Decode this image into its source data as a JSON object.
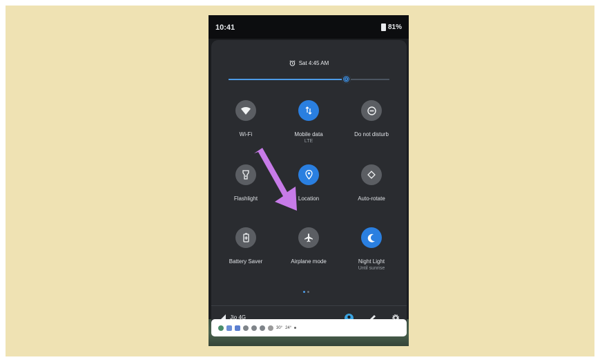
{
  "status_bar": {
    "time": "10:41",
    "battery": "81%"
  },
  "quick_settings": {
    "alarm": "Sat 4:45 AM",
    "brightness_level": 0.73,
    "tiles": [
      {
        "id": "wifi",
        "label": "Wi-Fi",
        "sublabel": "",
        "icon": "wifi-icon",
        "active": false
      },
      {
        "id": "mobile-data",
        "label": "Mobile data",
        "sublabel": "LTE",
        "icon": "mobile-data-icon",
        "active": true
      },
      {
        "id": "dnd",
        "label": "Do not disturb",
        "sublabel": "",
        "icon": "do-not-disturb-icon",
        "active": false
      },
      {
        "id": "flashlight",
        "label": "Flashlight",
        "sublabel": "",
        "icon": "flashlight-icon",
        "active": false
      },
      {
        "id": "location",
        "label": "Location",
        "sublabel": "",
        "icon": "location-icon",
        "active": true
      },
      {
        "id": "auto-rotate",
        "label": "Auto-rotate",
        "sublabel": "",
        "icon": "auto-rotate-icon",
        "active": false
      },
      {
        "id": "battery-saver",
        "label": "Battery Saver",
        "sublabel": "",
        "icon": "battery-saver-icon",
        "active": false
      },
      {
        "id": "airplane",
        "label": "Airplane mode",
        "sublabel": "",
        "icon": "airplane-icon",
        "active": false
      },
      {
        "id": "night-light",
        "label": "Night Light",
        "sublabel": "Until sunrise",
        "icon": "night-light-icon",
        "active": true
      }
    ],
    "page_indicator": {
      "pages": 2,
      "current": 1
    },
    "network": "Jio 4G"
  },
  "notification_bar": {
    "temps": [
      "30°",
      "24°"
    ]
  },
  "colors": {
    "accent": "#2a7fe0",
    "annotation_arrow": "#c77be8",
    "background": "#efe2b3"
  }
}
